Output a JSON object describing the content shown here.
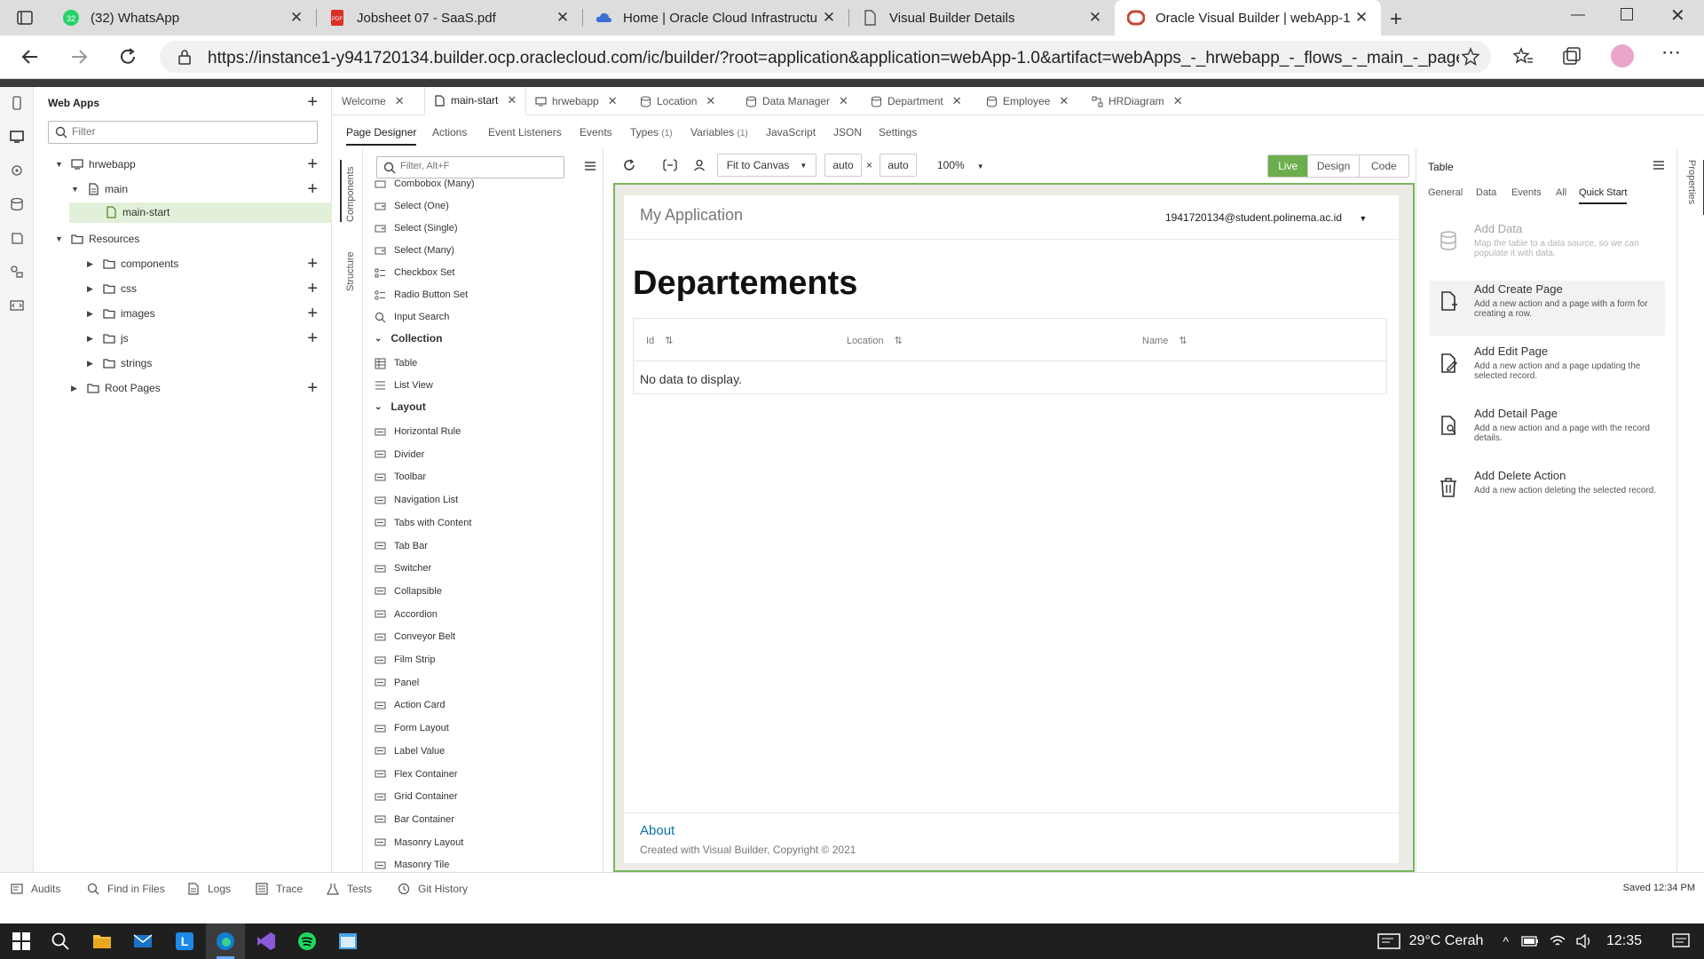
{
  "browser": {
    "tabs": [
      {
        "label": "(32) WhatsApp",
        "icon": "whatsapp-icon"
      },
      {
        "label": "Jobsheet 07 - SaaS.pdf",
        "icon": "pdf-icon"
      },
      {
        "label": "Home | Oracle Cloud Infrastructu",
        "icon": "cloud-icon"
      },
      {
        "label": "Visual Builder Details",
        "icon": "page-icon"
      },
      {
        "label": "Oracle Visual Builder | webApp-1",
        "icon": "oracle-icon"
      }
    ],
    "url": "https://instance1-y941720134.builder.ocp.oraclecloud.com/ic/builder/?root=application&application=webApp-1.0&artifact=webApps_-_hrwebapp_-_flows_-_main_-_pages_-_mai..."
  },
  "navigator": {
    "title": "Web Apps",
    "filter_placeholder": "Filter",
    "tree": {
      "app": "hrwebapp",
      "flow": "main",
      "page": "main-start",
      "resources": "Resources",
      "folders": [
        "components",
        "css",
        "images",
        "js",
        "strings"
      ],
      "root_pages": "Root Pages"
    }
  },
  "editor_tabs": [
    "Welcome",
    "main-start",
    "hrwebapp",
    "Location",
    "Data Manager",
    "Department",
    "Employee",
    "HRDiagram"
  ],
  "designer_tabs": [
    "Page Designer",
    "Actions",
    "Event Listeners",
    "Events",
    "Types",
    "(1)",
    "Variables",
    "(1)",
    "JavaScript",
    "JSON",
    "Settings"
  ],
  "palette": {
    "vertical_tabs": [
      "Components",
      "Structure"
    ],
    "filter_placeholder": "Filter, Alt+F",
    "items_top": [
      "Combobox (Many)",
      "Select (One)",
      "Select (Single)",
      "Select (Many)",
      "Checkbox Set",
      "Radio Button Set",
      "Input Search"
    ],
    "collection_title": "Collection",
    "collection_items": [
      "Table",
      "List View"
    ],
    "layout_title": "Layout",
    "layout_items": [
      "Horizontal Rule",
      "Divider",
      "Toolbar",
      "Navigation List",
      "Tabs with Content",
      "Tab Bar",
      "Switcher",
      "Collapsible",
      "Accordion",
      "Conveyor Belt",
      "Film Strip",
      "Panel",
      "Action Card",
      "Form Layout",
      "Label Value",
      "Flex Container",
      "Grid Container",
      "Bar Container",
      "Masonry Layout",
      "Masonry Tile"
    ]
  },
  "canvas_toolbar": {
    "fit": "Fit to Canvas",
    "width": "auto",
    "times": "×",
    "height": "auto",
    "zoom": "100%",
    "modes": [
      "Live",
      "Design",
      "Code"
    ]
  },
  "app_page": {
    "app_title": "My Application",
    "user": "1941720134@student.polinema.ac.id",
    "heading": "Departements",
    "columns": [
      "Id",
      "Location",
      "Name"
    ],
    "empty": "No data to display.",
    "footer_link": "About",
    "footer_text": "Created with Visual Builder, Copyright © 2021"
  },
  "properties": {
    "title": "Table",
    "tabs": [
      "General",
      "Data",
      "Events",
      "All",
      "Quick Start"
    ],
    "vertical_tab": "Properties",
    "quick_start": [
      {
        "title": "Add Data",
        "desc": "Map the table to a data source, so we can populate it with data.",
        "disabled": true
      },
      {
        "title": "Add Create Page",
        "desc": "Add a new action and a page with a form for creating a row.",
        "disabled": false
      },
      {
        "title": "Add Edit Page",
        "desc": "Add a new action and a page updating the selected record.",
        "disabled": false
      },
      {
        "title": "Add Detail Page",
        "desc": "Add a new action and a page with the record details.",
        "disabled": false
      },
      {
        "title": "Add Delete Action",
        "desc": "Add a new action deleting the selected record.",
        "disabled": false
      }
    ]
  },
  "bottom_bar": {
    "items": [
      "Audits",
      "Find in Files",
      "Logs",
      "Trace",
      "Tests",
      "Git History"
    ],
    "status": "Saved 12:34 PM"
  },
  "taskbar": {
    "weather": "29°C Cerah",
    "time": "12:35"
  },
  "colors": {
    "live_green": "#7ab55c",
    "link_blue": "#0a72a6",
    "oracle_red": "#c74634"
  }
}
